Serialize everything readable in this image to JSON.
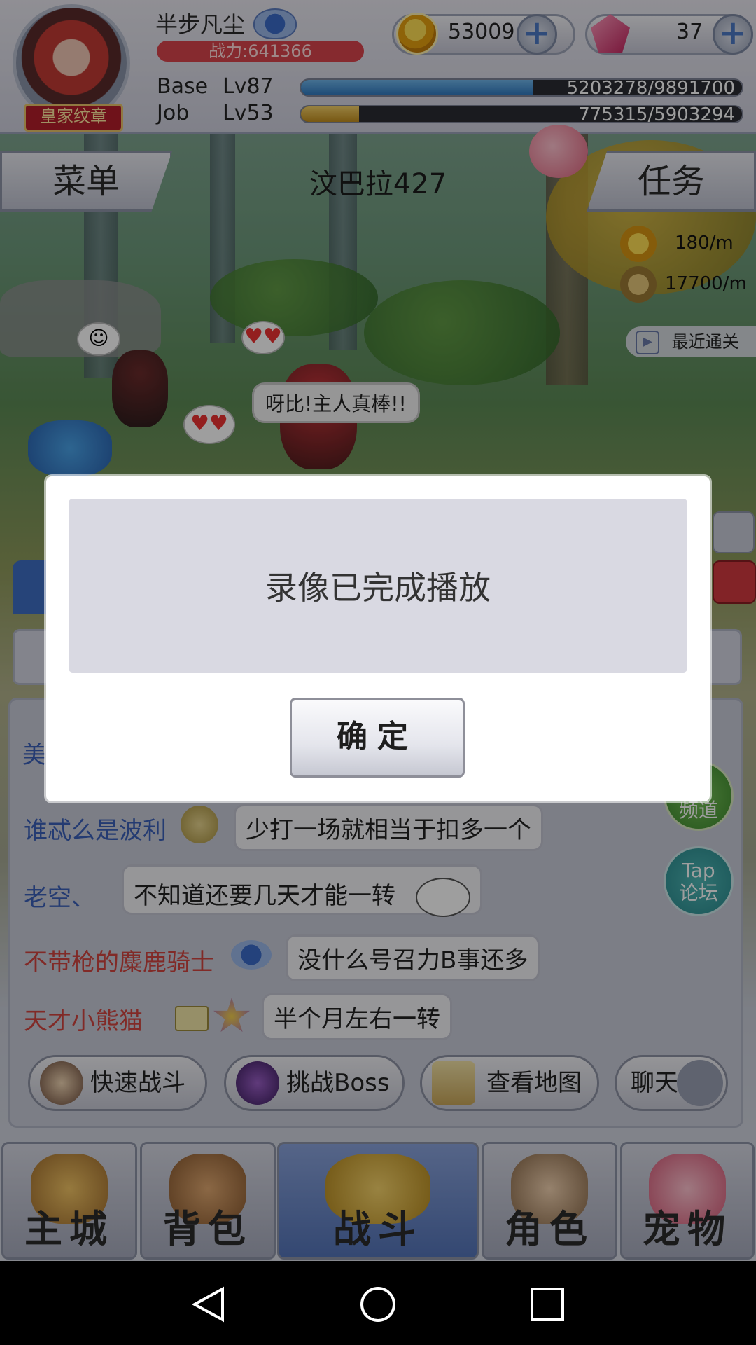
{
  "player": {
    "name": "半步凡尘",
    "badge": "皇家纹章",
    "power": "战力:641366"
  },
  "currency": {
    "zeny": "53009",
    "gems": "37"
  },
  "levels": {
    "base_label": "Base",
    "base_level": "Lv87",
    "base_exp": "5203278/9891700",
    "base_progress": 0.526,
    "job_label": "Job",
    "job_level": "Lv53",
    "job_exp": "775315/5903294",
    "job_progress": 0.131
  },
  "nav": {
    "menu": "菜单",
    "task": "任务",
    "map_name": "汶巴拉427"
  },
  "rates": {
    "zeny_rate": "180/m",
    "exp_rate": "17700/m",
    "replay": "最近通关"
  },
  "scene": {
    "speech": "呀比!主人真棒!!"
  },
  "chat": [
    {
      "name": "谁忒么是波利",
      "message": "少打一场就相当于扣多一个",
      "color": "#3a5fb8"
    },
    {
      "name": "老空、",
      "message": "不知道还要几天才能一转",
      "color": "#3a5fb8"
    },
    {
      "name": "不带枪的麋鹿骑士",
      "message": "没什么号召力B事还多",
      "color": "#d0453f"
    },
    {
      "name": "天才小熊猫",
      "message": "半个月左右一转",
      "color": "#d0453f"
    }
  ],
  "side_buttons": {
    "forum_line1": "Tap",
    "forum_line2": "论坛",
    "channel_line2": "频道"
  },
  "actions": {
    "quick_battle": "快速战斗",
    "challenge_boss": "挑战Boss",
    "view_map": "查看地图",
    "chat": "聊天"
  },
  "tabs": [
    "主城",
    "背包",
    "战斗",
    "角色",
    "宠物"
  ],
  "active_tab": "战斗",
  "dialog": {
    "message": "录像已完成播放",
    "ok": "确定"
  },
  "colors": {
    "base_bar": "#3f8fd1",
    "job_bar": "#d9a93a",
    "power_bg": "#d9444d",
    "active_tab": "#6b86c4"
  }
}
